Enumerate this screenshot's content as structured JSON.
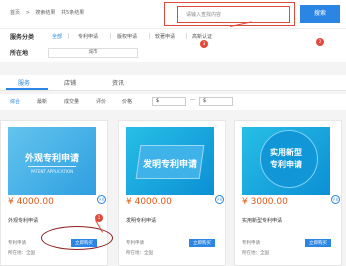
{
  "breadcrumb": [
    "首页",
    "搜索结果",
    "共5条结果"
  ],
  "search": {
    "placeholder": "请输入查找内容",
    "button_label": "搜索"
  },
  "filters": {
    "category_label": "服务分类",
    "categories": [
      "全部",
      "专利申请",
      "版权申请",
      "软著申请",
      "高新认证"
    ],
    "location_label": "所在地",
    "city_placeholder": "城市"
  },
  "tabs": [
    "服务",
    "店铺",
    "资讯"
  ],
  "sort": {
    "options": [
      "综合",
      "最新",
      "成交量",
      "评价",
      "价格"
    ],
    "price_from": "$",
    "price_to": "$"
  },
  "products": [
    {
      "image_title": "外观专利申请",
      "image_subtitle": "PATENT APPLICATION",
      "price": "¥ 4000.00",
      "name": "外观专利申请",
      "type_label": "专利申请",
      "location": "所在地：全国",
      "buy_label": "立即购买",
      "badge": "认证"
    },
    {
      "image_title": "发明专利申请",
      "price": "¥ 4000.00",
      "name": "发明专利申请",
      "type_label": "专利申请",
      "location": "所在地：全国",
      "buy_label": "立即购买",
      "badge": "认证"
    },
    {
      "image_title_line1": "实用新型",
      "image_title_line2": "专利申请",
      "price": "¥ 3000.00",
      "name": "实用新型专利申请",
      "type_label": "专利申请",
      "location": "所在地：全国",
      "buy_label": "立即购买",
      "badge": "认证"
    }
  ],
  "annotations": [
    "1",
    "2",
    "3"
  ],
  "colors": {
    "accent": "#2a85e4",
    "price": "#e05a16",
    "annotation": "#e04a3a"
  }
}
